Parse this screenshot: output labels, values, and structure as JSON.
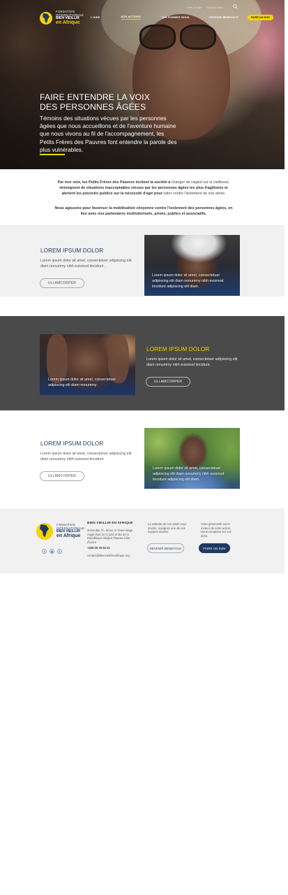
{
  "colors": {
    "navy": "#1d3a63",
    "yellow": "#f4d300",
    "dark_band": "#4a4a4a",
    "light_band": "#f1f1f1"
  },
  "header": {
    "logo": {
      "line1": "FONDATION",
      "line2": "INTERNATIONALE",
      "line3": "BIEN VIEILLIR",
      "line4": "en Afrique",
      "icon": "africa-sun-logo"
    },
    "utility": {
      "link1": "Cote d'ivoire",
      "link2": "Burkina Faso",
      "search_icon": "search-icon"
    },
    "nav": [
      {
        "label": "L'AIDE"
      },
      {
        "label": "NOS ACTIONS"
      },
      {
        "label": "QUI SOMMES NOUS"
      },
      {
        "label": "DEVENIR BENEVOLE"
      }
    ],
    "don_button": "FAIRE UN DON"
  },
  "hero": {
    "title_line1": "FAIRE ENTENDRE LA VOIX",
    "title_line2": "DES PERSONNES ÂGÉES",
    "text": "Témoins des situations vécues par les personnes âgées que nous accueillons et de l'aventure humaine que nous vivons au fil de l'accompagnement, les Petits Frères des Pauvres font entendre la parole des plus vulnérables."
  },
  "intro": {
    "p1_a": "Par leur voix, les Petits Frères des Pauvres incitent la société à",
    "p1_b": " changer de regard sur la vieillesse, ",
    "p1_c": "témoignent de situations inacceptables vécues par les personnes âgées les plus fragilisées et alertent les pouvoirs publics sur la nécessité d'agir pour",
    "p1_d": " lutter contre l'isolement de nos aînés.",
    "p2": "Nous agissons pour favoriser la mobilisation citoyenne contre l'isolement des personnes âgées, en lien avec nos partenaires institutionnels, privés, publics et associatifs."
  },
  "sections": [
    {
      "title": "LOREM IPSUM DOLOR",
      "text": "Lorem ipsum dolor sit amet, consectetuer adipiscing elit diam nonummy nibh euismod tincidunt .",
      "button": "ULLAMCORPER",
      "photo_caption": "Lorem ipsum dolor sit amet, consectetuer adipiscing elit diam nonummy nibh euismod tincidunt adipiscing elit diam."
    },
    {
      "title": "LOREM IPSUM DOLOR",
      "text": "Lorem ipsum dolor sit amet, consectetuer adipiscing elit diam nonummy nibh euismod tincidunt.",
      "button": "ULLAMCORPER",
      "photo_caption": "Lorem ipsum dolor sit amet, consectetuer adipiscing elit diam nonummy ."
    },
    {
      "title": "LOREM IPSUM DOLOR",
      "text": "Lorem ipsum dolor sit amet, consectetuer adipiscing elit diam nonummy nibh euismod tincidunt.",
      "button": "ULLAMCORPER",
      "photo_caption": "Lorem ipsum dolor sit amet, consectetuer adipiscing elit diam nonummy nibh euismod tincidunt adipiscing elit diam."
    }
  ],
  "footer": {
    "logo": {
      "line1": "FONDATION",
      "line2": "INTERNATIONALE",
      "line3": "BIEN VIEILLIR",
      "line4": "en Afrique"
    },
    "socials": [
      {
        "icon": "twitter-icon",
        "glyph": "t"
      },
      {
        "icon": "instagram-icon",
        "glyph": "◎"
      },
      {
        "icon": "facebook-icon",
        "glyph": "f"
      }
    ],
    "org_title": "BIEN VIEILLIR EN AFRIQUE",
    "address": "Immeuble YL, 6eme et 7eme étage Angle Rue Dr Crozet et Bd de la République Abidjan Plateau Côte d'ivoire",
    "phone": "+225 20 30 92 21",
    "email": "contact@bienvieillirenafrique.org",
    "mid_text": "La solitude de nos aînés vous touche, rejoignez une de nos équipes locales.",
    "benevole_button": "DEVENIR BENEVOLE",
    "right_text": "Votre générosité est le moteur de notre action. Nous comptons sur vos dons.",
    "don_button": "FAIRE UN DON"
  }
}
